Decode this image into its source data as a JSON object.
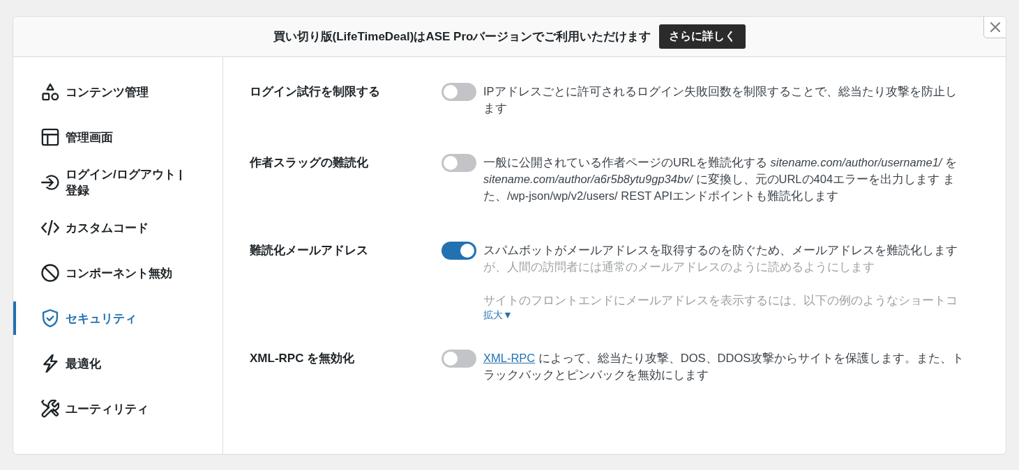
{
  "banner": {
    "text": "買い切り版(LifeTimeDeal)はASE Proバージョンでご利用いただけます",
    "button": "さらに詳しく"
  },
  "sidebar": {
    "items": [
      {
        "label": "コンテンツ管理",
        "selected": false
      },
      {
        "label": "管理画面",
        "selected": false
      },
      {
        "label": "ログイン/ログアウト | 登録",
        "selected": false
      },
      {
        "label": "カスタムコード",
        "selected": false
      },
      {
        "label": "コンポーネント無効",
        "selected": false
      },
      {
        "label": "セキュリティ",
        "selected": true
      },
      {
        "label": "最適化",
        "selected": false
      },
      {
        "label": "ユーティリティ",
        "selected": false
      }
    ]
  },
  "settings": [
    {
      "label": "ログイン試行を制限する",
      "on": false,
      "description": "IPアドレスごとに許可されるログイン失敗回数を制限することで、総当たり攻撃を防止します"
    },
    {
      "label": "作者スラッグの難読化",
      "on": false,
      "description": "一般に公開されている作者ページのURLを難読化する *sitename.com/author/username1/* を *sitename.com/author/a6r5b8ytu9gp34bv/* に変換し、元のURLの404エラーを出力します また、/wp-json/wp/v2/users/ REST APIエンドポイントも難読化します"
    },
    {
      "label": "難読化メールアドレス",
      "on": true,
      "description": "スパムボットがメールアドレスを取得するのを防ぐため、メールアドレスを難読化しますが、人間の訪問者には通常のメールアドレスのように読めるようにします",
      "more": {
        "text": "サイトのフロントエンドにメールアドレスを表示するには、以下の例のようなショートコ",
        "expanded": false,
        "toggle": "拡大▼"
      }
    },
    {
      "label": "XML-RPC を無効化",
      "on": false,
      "link": "XML-RPC",
      "description": "によって、総当たり攻撃、DOS、DDOS攻撃からサイトを保護します。また、トラックバックとピンバックを無効にします"
    }
  ]
}
